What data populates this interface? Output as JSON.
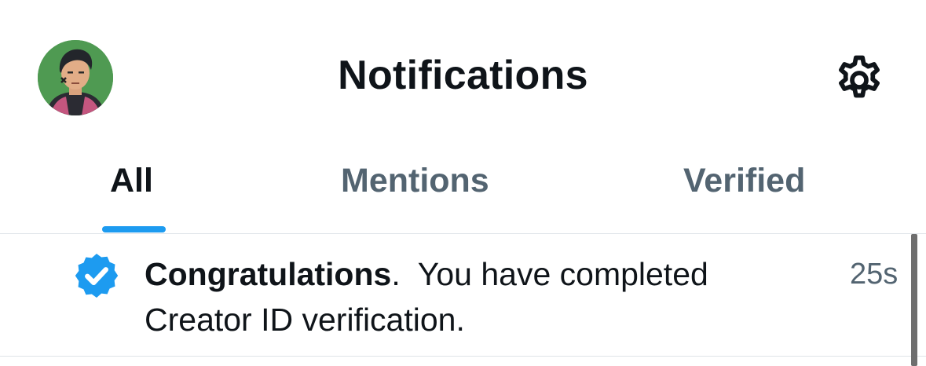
{
  "header": {
    "title": "Notifications",
    "avatar_icon": "user-avatar",
    "settings_icon": "gear-icon"
  },
  "tabs": [
    {
      "label": "All",
      "active": true
    },
    {
      "label": "Mentions",
      "active": false
    },
    {
      "label": "Verified",
      "active": false
    }
  ],
  "notifications": [
    {
      "icon": "verified-badge-icon",
      "bold_text": "Congratulations",
      "text": ".  You have completed Creator ID verification.",
      "time": "25s"
    }
  ],
  "colors": {
    "accent": "#1d9bf0",
    "primary_text": "#0f1419",
    "secondary_text": "#536471",
    "divider": "#dfe4e8"
  }
}
